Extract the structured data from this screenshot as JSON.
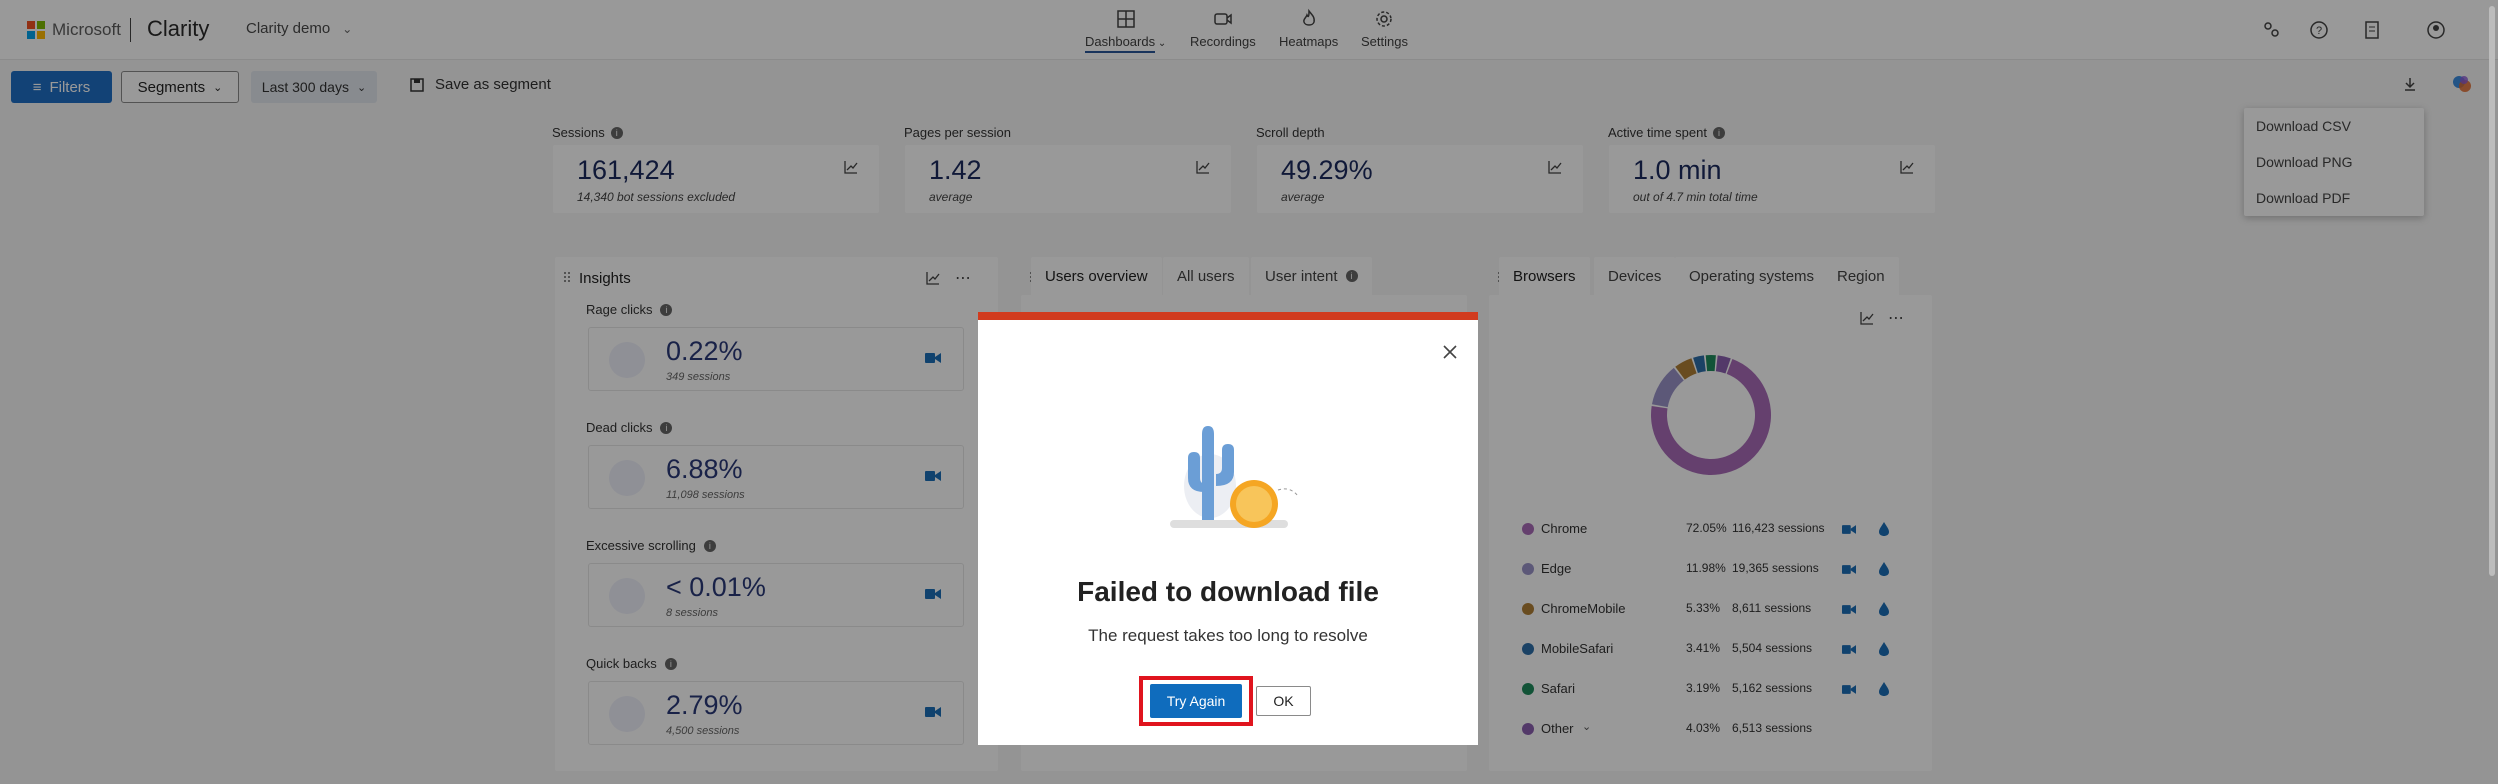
{
  "header": {
    "brand": "Microsoft",
    "app": "Clarity",
    "project": "Clarity demo",
    "nav": [
      {
        "label": "Dashboards",
        "icon": "dashboard-icon",
        "active": true
      },
      {
        "label": "Recordings",
        "icon": "video-icon"
      },
      {
        "label": "Heatmaps",
        "icon": "flame-icon"
      },
      {
        "label": "Settings",
        "icon": "gear-icon"
      }
    ],
    "colors": {
      "ms_red": "#f25022",
      "ms_green": "#7fba00",
      "ms_blue": "#00a4ef",
      "ms_yellow": "#ffb900"
    }
  },
  "toolbar": {
    "filters": "Filters",
    "segments": "Segments",
    "range": "Last 300 days",
    "save": "Save as segment"
  },
  "download_menu": [
    "Download CSV",
    "Download PNG",
    "Download PDF"
  ],
  "kpis": [
    {
      "label": "Sessions",
      "value": "161,424",
      "sub": "14,340 bot sessions excluded"
    },
    {
      "label": "Pages per session",
      "value": "1.42",
      "sub": "average"
    },
    {
      "label": "Scroll depth",
      "value": "49.29%",
      "sub": "average"
    },
    {
      "label": "Active time spent",
      "value": "1.0 min",
      "sub": "out of 4.7 min total time"
    }
  ],
  "insights": {
    "title": "Insights",
    "items": [
      {
        "label": "Rage clicks",
        "value": "0.22%",
        "sub": "349 sessions"
      },
      {
        "label": "Dead clicks",
        "value": "6.88%",
        "sub": "11,098 sessions"
      },
      {
        "label": "Excessive scrolling",
        "value": "< 0.01%",
        "sub": "8 sessions"
      },
      {
        "label": "Quick backs",
        "value": "2.79%",
        "sub": "4,500 sessions"
      }
    ]
  },
  "users_tabs": [
    "Users overview",
    "All users",
    "User intent"
  ],
  "browser_tabs": [
    "Browsers",
    "Devices",
    "Operating systems",
    "Region"
  ],
  "browsers": [
    {
      "name": "Chrome",
      "pct": "72.05%",
      "sessions": "116,423 sessions",
      "color": "#a86bb8",
      "share": 72.05
    },
    {
      "name": "Edge",
      "pct": "11.98%",
      "sessions": "19,365 sessions",
      "color": "#9a93c8",
      "share": 11.98
    },
    {
      "name": "ChromeMobile",
      "pct": "5.33%",
      "sessions": "8,611 sessions",
      "color": "#b07f36",
      "share": 5.33
    },
    {
      "name": "MobileSafari",
      "pct": "3.41%",
      "sessions": "5,504 sessions",
      "color": "#2d6ea8",
      "share": 3.41
    },
    {
      "name": "Safari",
      "pct": "3.19%",
      "sessions": "5,162 sessions",
      "color": "#1f8a5c",
      "share": 3.19
    },
    {
      "name": "Other",
      "pct": "4.03%",
      "sessions": "6,513 sessions",
      "color": "#8b5fb0",
      "share": 4.03
    }
  ],
  "dialog": {
    "title": "Failed to download file",
    "message": "The request takes too long to resolve",
    "primary": "Try Again",
    "secondary": "OK",
    "accent": "#d13b1e"
  }
}
